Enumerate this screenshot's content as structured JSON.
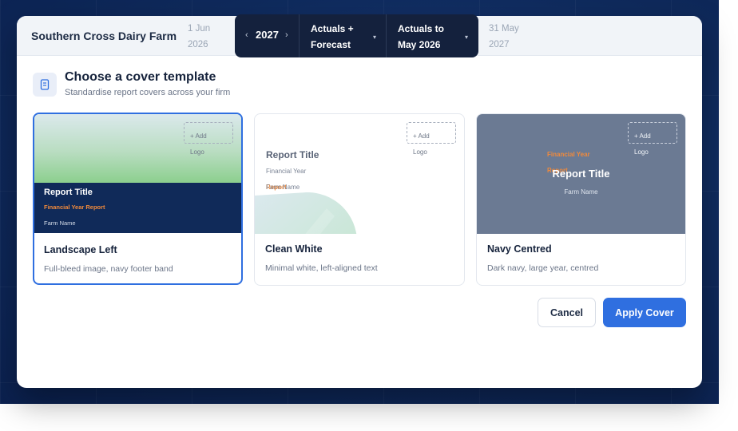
{
  "topbar": {
    "farm_name": "Southern Cross Dairy Farm",
    "date_start_line1": "1 Jun",
    "date_start_line2": "2026",
    "year": "2027",
    "prev_icon": "chevron-left-icon",
    "next_icon": "chevron-right-icon",
    "basis_line1": "Actuals +",
    "basis_line2": "Forecast",
    "asof_line1": "Actuals to",
    "asof_line2": "May 2026",
    "date_end_line1": "31 May",
    "date_end_line2": "2027"
  },
  "header": {
    "icon": "document-icon",
    "title": "Choose a cover template",
    "subtitle": "Standardise report covers across your firm"
  },
  "preview_text": {
    "report_title": "Report Title",
    "fy_report": "Financial Year Report",
    "financial_year": "Financial Year",
    "report_word": "Report",
    "farm_name": "Farm Name",
    "logo_line1": "+ Add",
    "logo_line2": "Logo"
  },
  "templates": [
    {
      "name": "Landscape Left",
      "description": "Full-bleed image, navy footer band",
      "selected": true
    },
    {
      "name": "Clean White",
      "description": "Minimal white, left-aligned text",
      "selected": false
    },
    {
      "name": "Navy Centred",
      "description": "Dark navy, large year, centred",
      "selected": false
    }
  ],
  "actions": {
    "cancel": "Cancel",
    "apply": "Apply Cover"
  },
  "colors": {
    "accent": "#2f6fe0",
    "navy": "#102a59",
    "orange": "#f08a3c"
  }
}
